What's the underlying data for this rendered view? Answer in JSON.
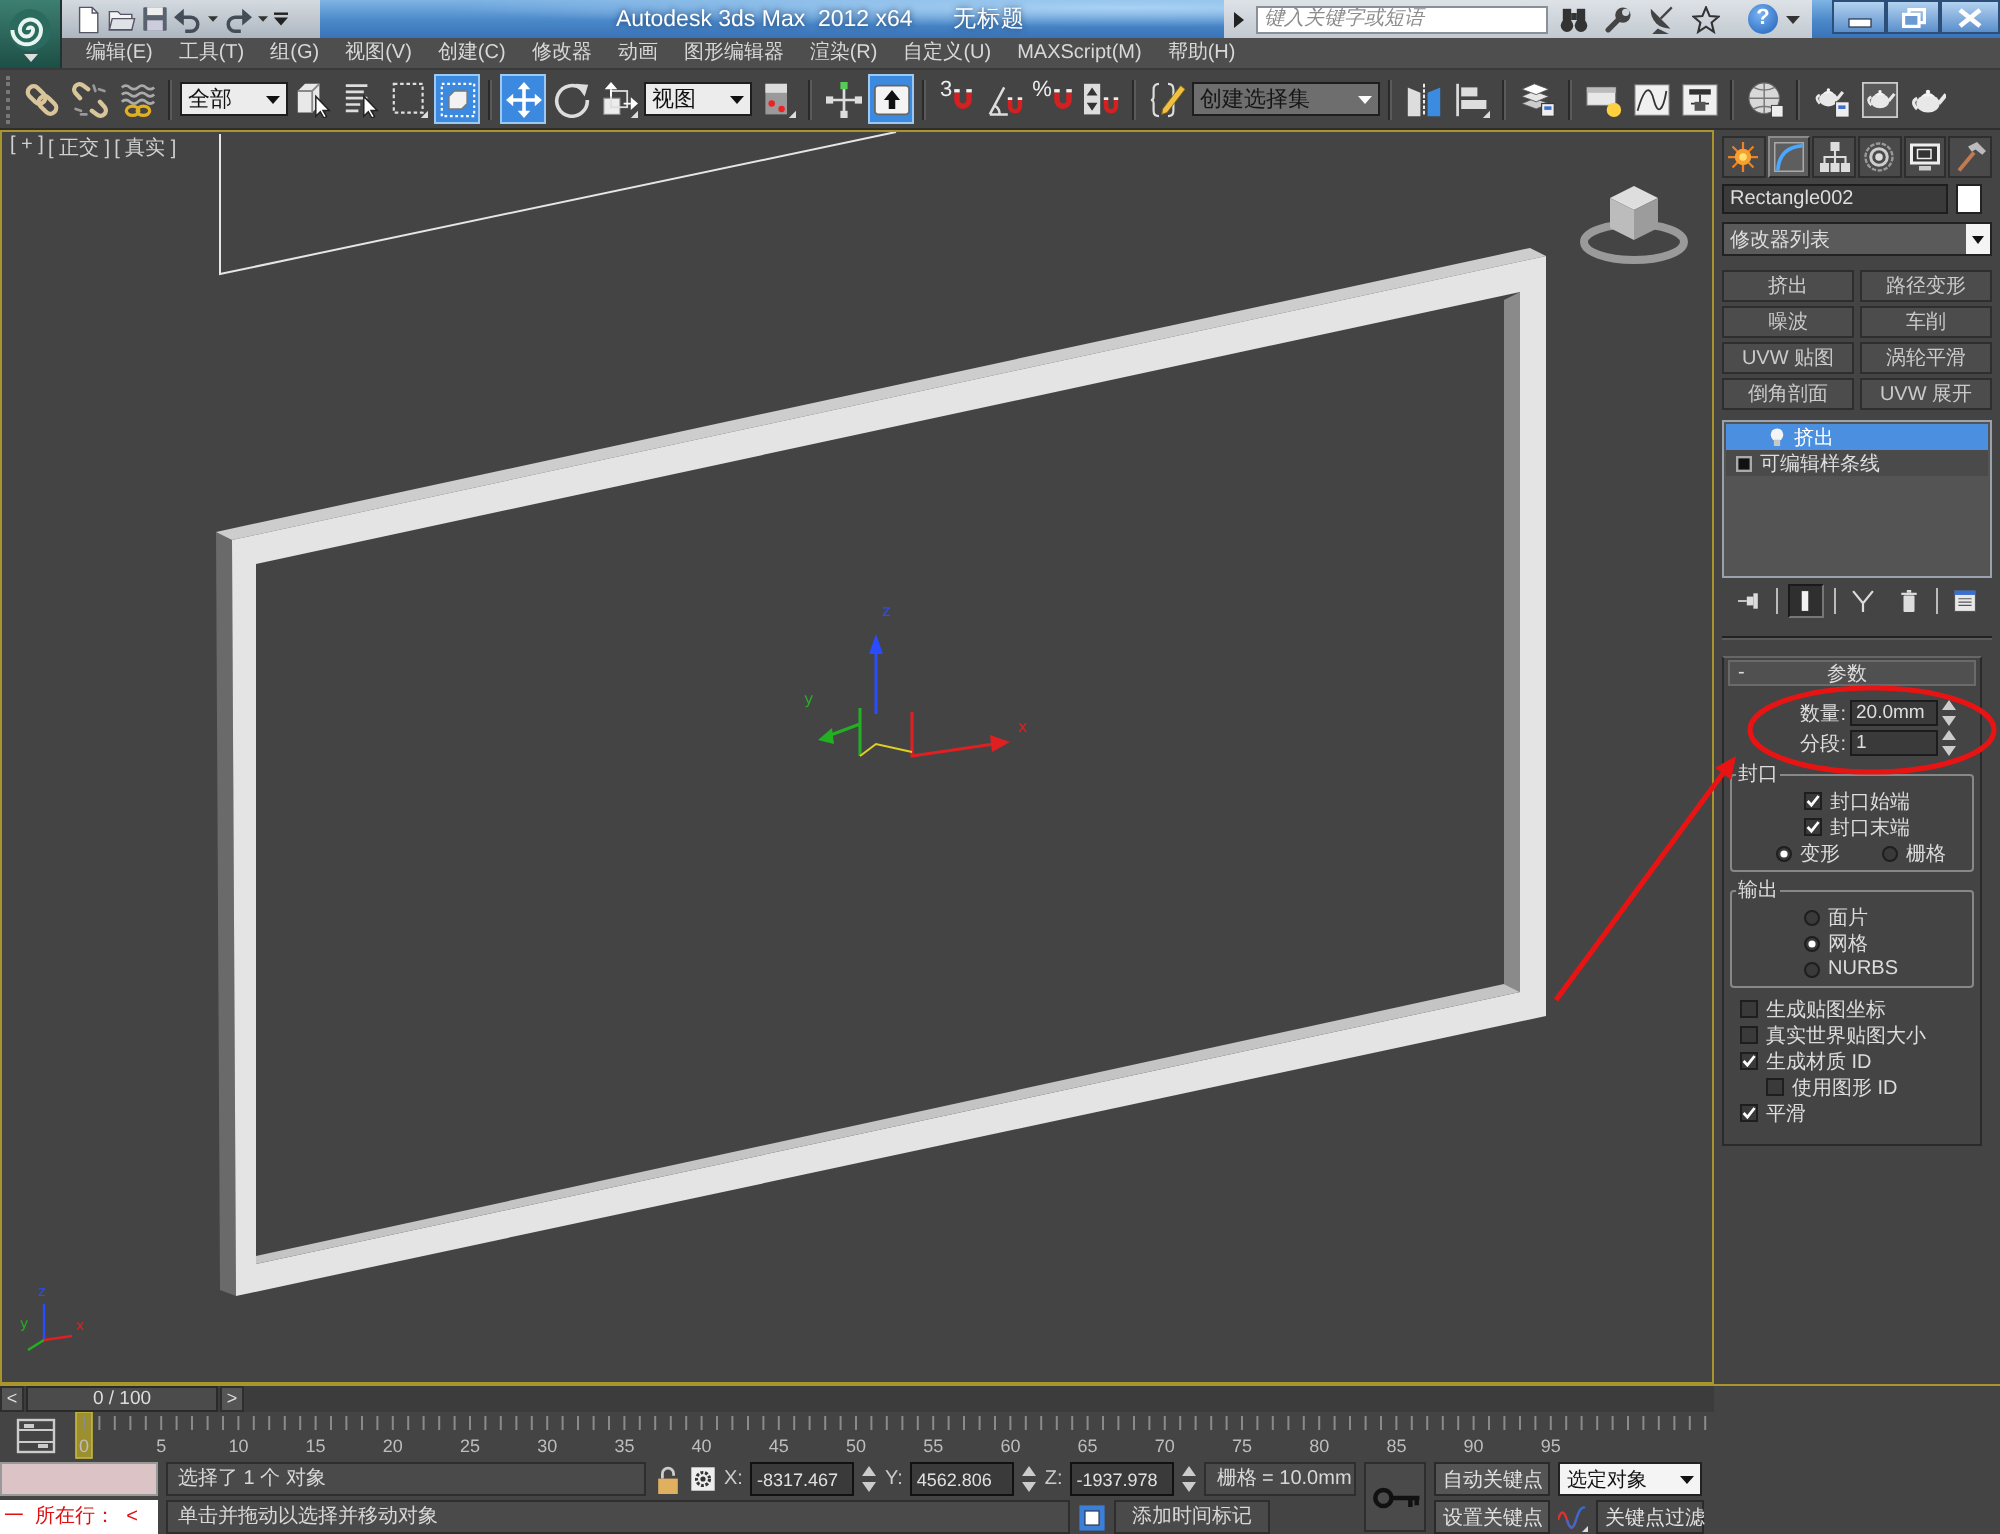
{
  "title_bar": {
    "title": "Autodesk 3ds Max  2012 x64",
    "document": "无标题",
    "search": {
      "placeholder": "键入关键字或短语"
    },
    "help": "?"
  },
  "menu_bar": [
    "编辑(E)",
    "工具(T)",
    "组(G)",
    "视图(V)",
    "创建(C)",
    "修改器",
    "动画",
    "图形编辑器",
    "渲染(R)",
    "自定义(U)",
    "MAXScript(M)",
    "帮助(H)"
  ],
  "main_toolbar": {
    "buttons": [
      {
        "selected": false
      },
      {
        "selected": false
      },
      {
        "selected": false
      },
      {
        "selected": false
      },
      {
        "selected": false
      },
      {
        "selected": false
      },
      {
        "selected": true
      },
      {
        "selected": true
      },
      {
        "selected": false
      },
      {
        "selected": false
      },
      {
        "selected": false
      },
      {
        "selected": false
      },
      {
        "selected": true
      },
      {
        "selected": false
      },
      {
        "selected": false
      },
      {
        "selected": false
      },
      {
        "selected": false
      },
      {
        "selected": false
      },
      {
        "selected": false
      },
      {
        "selected": false
      },
      {
        "selected": false
      },
      {
        "selected": false
      },
      {
        "selected": false
      },
      {
        "selected": false
      },
      {
        "selected": false
      },
      {
        "selected": false
      },
      {
        "selected": false
      },
      {
        "selected": false
      }
    ],
    "selection_filter": "全部",
    "reference_coordinates": "视图",
    "snap_dimension": "3",
    "percent_symbol": "%",
    "named_selection": {
      "placeholder": "创建选择集"
    }
  },
  "viewport": {
    "labels": [
      "[ + ]",
      "[ 正交 ]",
      "[ 真实 ]"
    ],
    "active": true,
    "gizmo_axes": [
      "z",
      "y",
      "x"
    ],
    "world_axes": [
      "z",
      "y",
      "x"
    ]
  },
  "command_panel": {
    "tabs": [
      {
        "selected": false
      },
      {
        "selected": true
      },
      {
        "selected": false
      },
      {
        "selected": false
      },
      {
        "selected": false
      },
      {
        "selected": false
      }
    ],
    "object_name": "Rectangle002",
    "modifier_list": "修改器列表",
    "modifier_buttons": [
      "挤出",
      "路径变形",
      "噪波",
      "车削",
      "UVW 贴图",
      "涡轮平滑",
      "倒角剖面",
      "UVW 展开"
    ],
    "modifier_stack": [
      {
        "label": "挤出",
        "kind": "modifier",
        "selected": true
      },
      {
        "label": "可编辑样条线",
        "kind": "base_object",
        "selected": false
      }
    ],
    "stack_tools": [
      {
        "selected": false
      },
      {
        "selected": true
      },
      {
        "selected": false
      },
      {
        "selected": false
      },
      {
        "selected": false
      }
    ],
    "parameters": {
      "collapse_sign": "-",
      "title": "参数",
      "spinners": [
        {
          "label": "数量:",
          "value": "20.0mm"
        },
        {
          "label": "分段:",
          "value": "1"
        }
      ],
      "capping": {
        "title": "封口",
        "checkboxes": [
          {
            "label": "封口始端",
            "checked": true
          },
          {
            "label": "封口末端",
            "checked": true
          }
        ],
        "radios": [
          {
            "label": "变形",
            "selected": true
          },
          {
            "label": "栅格",
            "selected": false
          }
        ]
      },
      "output": {
        "title": "输出",
        "radios": [
          {
            "label": "面片",
            "selected": false
          },
          {
            "label": "网格",
            "selected": true
          },
          {
            "label": "NURBS",
            "selected": false
          }
        ]
      },
      "options": [
        {
          "label": "生成贴图坐标",
          "checked": false
        },
        {
          "label": "真实世界贴图大小",
          "checked": false
        },
        {
          "label": "生成材质 ID",
          "checked": true,
          "children": [
            {
              "label": "使用图形 ID",
              "checked": false
            }
          ]
        },
        {
          "label": "平滑",
          "checked": true
        }
      ]
    }
  },
  "time_slider": {
    "previous": "<",
    "position": "0 / 100",
    "next": ">",
    "level": 0
  },
  "track_bar": {
    "labels": [
      "0",
      "5",
      "10",
      "15",
      "20",
      "25",
      "30",
      "35",
      "40",
      "45",
      "50",
      "55",
      "60",
      "65",
      "70",
      "75",
      "80",
      "85",
      "90",
      "95"
    ]
  },
  "status_bar": {
    "listener_output": "一  所在行：  <",
    "selection": "选择了 1 个 对象",
    "prompt": "单击并拖动以选择并移动对象",
    "coordinates": [
      {
        "axis": "X:",
        "value": "-8317.467"
      },
      {
        "axis": "Y:",
        "value": "4562.806"
      },
      {
        "axis": "Z:",
        "value": "-1937.978"
      }
    ],
    "grid": "栅格 = 10.0mm",
    "time_tag": "添加时间标记",
    "auto_key": "自动关键点",
    "key_mode": "选定对象",
    "set_key": "设置关键点",
    "key_filters": "关键点过滤"
  }
}
